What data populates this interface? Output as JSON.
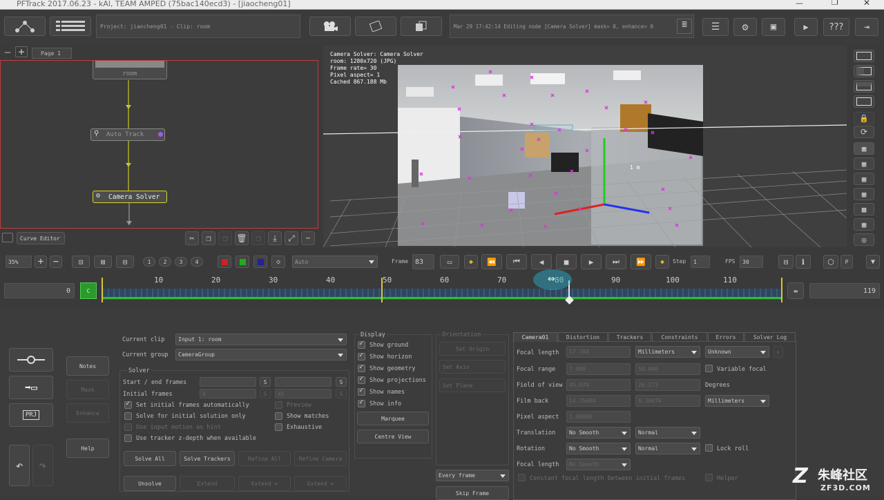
{
  "titlebar": {
    "title": "PFTrack 2017.06.23 - kAl, TEAM AMPED (75bac140ecd3) - [jiaocheng01]"
  },
  "header": {
    "project": "Project: jiaocheng01 - Clip: room",
    "status": "Mar 29 17:42:14 Editing node [Camera Solver] mask= 0, enhance= 0",
    "help_label": "???"
  },
  "tree": {
    "page_tab": "Page 1",
    "nodes": {
      "room": "room",
      "auto_track": "Auto Track",
      "camera_solver": "Camera Solver"
    },
    "curve_editor": "Curve Editor"
  },
  "viewer": {
    "info": [
      "Camera Solver: Camera Solver",
      "room: 1280x720 (JPG)",
      "Frame rate= 30",
      "Pixel aspect= 1",
      "Cached 867.188 Mb"
    ],
    "scale_label": "1 m"
  },
  "transport": {
    "zoom": "35%",
    "presets": [
      "1",
      "2",
      "3",
      "4"
    ],
    "mode": "Auto",
    "frame_label": "Frame",
    "frame": "83",
    "step_label": "Step",
    "step": "1",
    "fps_label": "FPS",
    "fps": "30",
    "p_label": "P"
  },
  "timeline": {
    "start": "0",
    "end": "119",
    "c_label": "C",
    "ticks": [
      "10",
      "20",
      "30",
      "40",
      "50",
      "60",
      "70",
      "80",
      "90",
      "100",
      "110"
    ]
  },
  "left_buttons": {
    "notes": "Notes",
    "mask": "Mask",
    "enhance": "Enhance",
    "help": "Help",
    "prj": "PRJ"
  },
  "solver": {
    "current_clip_label": "Current clip",
    "current_clip": "Input 1: room",
    "current_group_label": "Current group",
    "current_group": "CameraGroup",
    "section": "Solver",
    "start_end_label": "Start / end frames",
    "initial_frames_label": "Initial frames",
    "initial_a": "0",
    "initial_b": "45",
    "s_label": "S",
    "set_initial": "Set initial frames automatically",
    "preview": "Preview",
    "initial_only": "Solve for initial solution only",
    "show_matches": "Show matches",
    "input_motion": "Use input motion as hint",
    "exhaustive": "Exhaustive",
    "tracker_depth": "Use tracker z-depth when available",
    "solve_all": "Solve All",
    "solve_trackers": "Solve Trackers",
    "refine_all": "Refine All",
    "refine_camera": "Refine Camera",
    "unsolve": "Unsolve",
    "extend": "Extend",
    "extend_l": "Extend <",
    "extend_r": "Extend >"
  },
  "display": {
    "title": "Display",
    "items": [
      "Show ground",
      "Show horizon",
      "Show geometry",
      "Show projections",
      "Show names",
      "Show info"
    ],
    "marquee": "Marquee",
    "centre_view": "Centre View"
  },
  "orientation": {
    "title": "Orientation",
    "set_origin": "Set Origin",
    "set_axis": "Set Axis",
    "set_plane": "Set Plane",
    "every_frame": "Every frame",
    "skip_frame": "Skip Frame"
  },
  "camera": {
    "tabs": [
      "Camera01",
      "Distortion",
      "Trackers",
      "Constraints",
      "Errors",
      "Solver Log"
    ],
    "focal_length_label": "Focal length",
    "focal_length": "17.780",
    "units": "Millimeters",
    "unknown": "Unknown",
    "focal_range_label": "Focal range",
    "fr_min": "7.000",
    "fr_max": "50.000",
    "variable_focal": "Variable focal",
    "fov_label": "Field of view",
    "fov_a": "45.078",
    "fov_b": "26.273",
    "degrees": "Degrees",
    "film_back_label": "Film back",
    "fb_a": "14.75680",
    "fb_b": "8.30070",
    "fb_units": "Millimeters",
    "pixel_aspect_label": "Pixel aspect",
    "pixel_aspect": "1.00000",
    "translation_label": "Translation",
    "no_smooth": "No Smooth",
    "normal": "Normal",
    "rotation_label": "Rotation",
    "lock_roll": "Lock roll",
    "focal_length2_label": "Focal length",
    "constant_focal": "Constant focal length between initial frames",
    "helper": "Helper"
  },
  "watermark": {
    "cn": "朱峰社区",
    "url": "ZF3D.COM"
  }
}
